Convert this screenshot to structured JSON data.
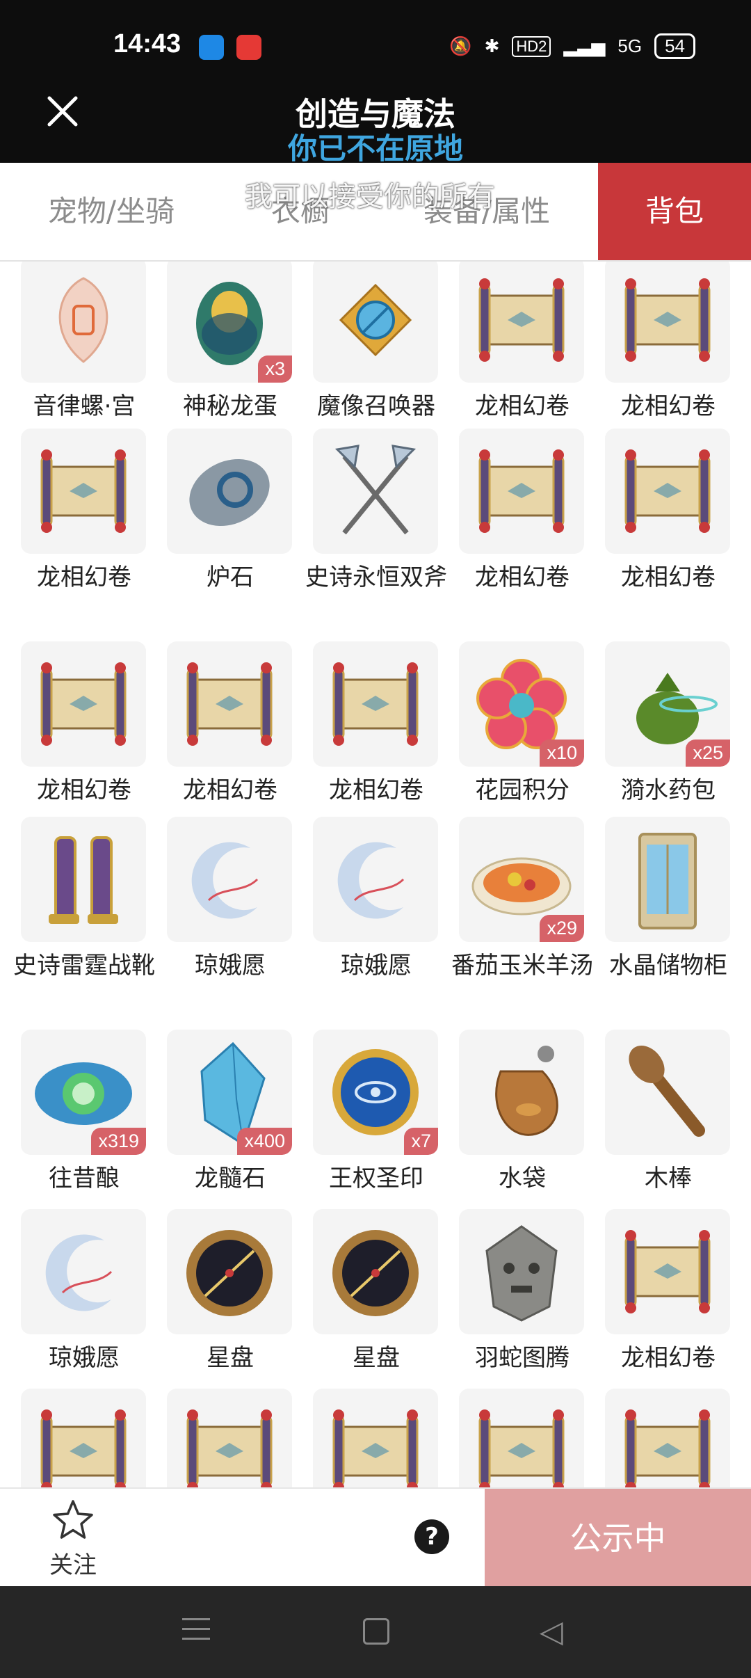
{
  "status_bar": {
    "time": "14:43",
    "hd_label": "HD2",
    "network": "5G",
    "battery": "54",
    "icons": [
      "mute-icon",
      "bluetooth-icon",
      "signal-icon",
      "wifi-icon",
      "battery-icon"
    ]
  },
  "header": {
    "title": "创造与魔法",
    "subtitle": "你已不在原地",
    "close_icon": "close-icon"
  },
  "overlay_text": "我可以接受你的所有",
  "tabs": [
    {
      "label": "宠物/坐骑",
      "active": false
    },
    {
      "label": "衣橱",
      "active": false
    },
    {
      "label": "装备/属性",
      "active": false
    },
    {
      "label": "背包",
      "active": true
    }
  ],
  "items": [
    {
      "name": "音律螺·宫",
      "badge": "",
      "icon": "conch-icon"
    },
    {
      "name": "神秘龙蛋",
      "badge": "x3",
      "icon": "dragon-egg-icon"
    },
    {
      "name": "魔像召唤器",
      "badge": "",
      "icon": "summoner-icon"
    },
    {
      "name": "龙相幻卷",
      "badge": "",
      "icon": "scroll-icon"
    },
    {
      "name": "龙相幻卷",
      "badge": "",
      "icon": "scroll-icon"
    },
    {
      "name": "龙相幻卷",
      "badge": "",
      "icon": "scroll-icon"
    },
    {
      "name": "炉石",
      "badge": "",
      "icon": "hearthstone-icon"
    },
    {
      "name": "史诗永恒双斧",
      "badge": "",
      "icon": "double-axe-icon"
    },
    {
      "name": "龙相幻卷",
      "badge": "",
      "icon": "scroll-icon"
    },
    {
      "name": "龙相幻卷",
      "badge": "",
      "icon": "scroll-icon"
    },
    {
      "name": "龙相幻卷",
      "badge": "",
      "icon": "scroll-icon"
    },
    {
      "name": "龙相幻卷",
      "badge": "",
      "icon": "scroll-icon"
    },
    {
      "name": "龙相幻卷",
      "badge": "",
      "icon": "scroll-icon"
    },
    {
      "name": "花园积分",
      "badge": "x10",
      "icon": "flower-icon"
    },
    {
      "name": "漪水药包",
      "badge": "x25",
      "icon": "potion-bag-icon"
    },
    {
      "name": "史诗雷霆战靴",
      "badge": "",
      "icon": "boots-icon"
    },
    {
      "name": "琼娥愿",
      "badge": "",
      "icon": "moon-wish-icon"
    },
    {
      "name": "琼娥愿",
      "badge": "",
      "icon": "moon-wish-icon"
    },
    {
      "name": "番茄玉米羊汤",
      "badge": "x29",
      "icon": "soup-icon"
    },
    {
      "name": "水晶储物柜",
      "badge": "",
      "icon": "cabinet-icon"
    },
    {
      "name": "往昔酿",
      "badge": "x319",
      "icon": "brew-icon"
    },
    {
      "name": "龙髓石",
      "badge": "x400",
      "icon": "crystal-icon"
    },
    {
      "name": "王权圣印",
      "badge": "x7",
      "icon": "seal-icon"
    },
    {
      "name": "水袋",
      "badge": "",
      "icon": "water-bag-icon"
    },
    {
      "name": "木棒",
      "badge": "",
      "icon": "club-icon"
    },
    {
      "name": "琼娥愿",
      "badge": "",
      "icon": "moon-wish-icon"
    },
    {
      "name": "星盘",
      "badge": "",
      "icon": "astrolabe-icon"
    },
    {
      "name": "星盘",
      "badge": "",
      "icon": "astrolabe-icon"
    },
    {
      "name": "羽蛇图腾",
      "badge": "",
      "icon": "totem-icon"
    },
    {
      "name": "龙相幻卷",
      "badge": "",
      "icon": "scroll-icon"
    },
    {
      "name": "",
      "badge": "",
      "icon": "scroll-icon"
    },
    {
      "name": "",
      "badge": "",
      "icon": "scroll-icon"
    },
    {
      "name": "",
      "badge": "",
      "icon": "scroll-icon"
    },
    {
      "name": "",
      "badge": "",
      "icon": "scroll-icon"
    },
    {
      "name": "",
      "badge": "",
      "icon": "scroll-icon"
    }
  ],
  "bottom_bar": {
    "follow_label": "关注",
    "help_label": "?",
    "public_button": "公示中"
  }
}
